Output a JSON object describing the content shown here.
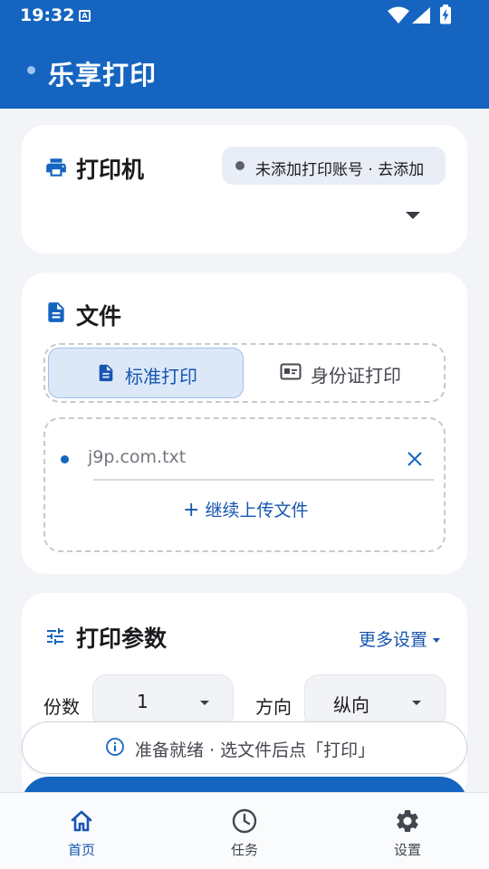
{
  "status_bar": {
    "time": "19:32",
    "notification_glyph": "A"
  },
  "app_bar": {
    "title": "乐享打印"
  },
  "printer_card": {
    "title": "打印机",
    "account_chip": "未添加打印账号 · 去添加"
  },
  "file_card": {
    "title": "文件",
    "tabs": [
      {
        "label": "标准打印",
        "active": true
      },
      {
        "label": "身份证打印",
        "active": false
      }
    ],
    "file_name": "j9p.com.txt",
    "add_more": "继续上传文件"
  },
  "params_card": {
    "title": "打印参数",
    "more_settings": "更多设置",
    "copies_label": "份数",
    "copies_value": "1",
    "orientation_label": "方向",
    "orientation_value": "纵向"
  },
  "snackbar": {
    "message": "准备就绪 · 选文件后点「打印」"
  },
  "bottom_nav": [
    {
      "label": "首页",
      "icon": "home-icon",
      "active": true
    },
    {
      "label": "任务",
      "icon": "clock-icon",
      "active": false
    },
    {
      "label": "设置",
      "icon": "gear-icon",
      "active": false
    }
  ],
  "colors": {
    "primary": "#1565c0",
    "accent_text": "#1755b0",
    "background": "#f2f4f8"
  }
}
